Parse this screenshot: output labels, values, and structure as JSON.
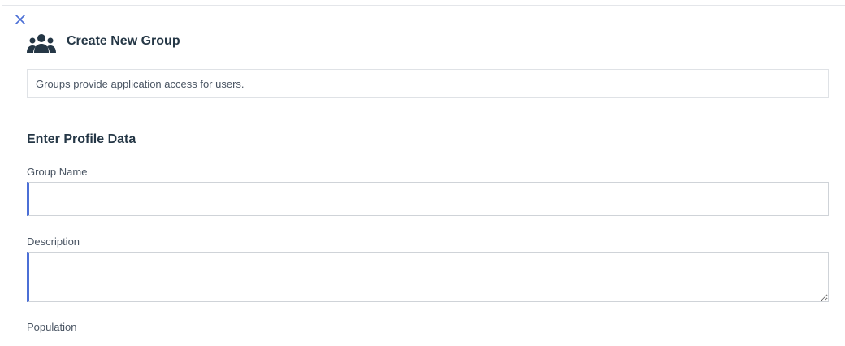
{
  "header": {
    "title": "Create New Group",
    "close_icon": "close-icon",
    "group_icon": "users-group-icon"
  },
  "info": {
    "text": "Groups provide application access for users."
  },
  "form": {
    "section_title": "Enter Profile Data",
    "group_name": {
      "label": "Group Name",
      "value": "",
      "placeholder": ""
    },
    "description": {
      "label": "Description",
      "value": "",
      "placeholder": ""
    },
    "population": {
      "label": "Population"
    }
  },
  "colors": {
    "accent": "#4b6fd6",
    "text": "#253746",
    "border": "#cfd3d8"
  }
}
